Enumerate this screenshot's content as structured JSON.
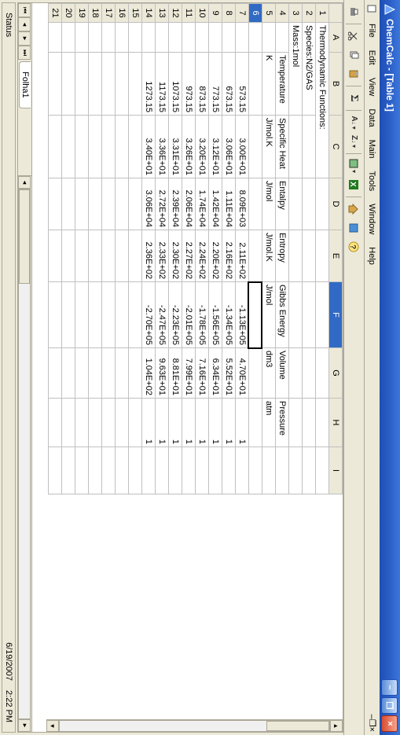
{
  "window": {
    "title": "ChemCalc - [Table 1]"
  },
  "menu": {
    "file": "File",
    "edit": "Edit",
    "view": "View",
    "data": "Data",
    "main": "Main",
    "tools": "Tools",
    "window": "Window",
    "help": "Help"
  },
  "columns": [
    "A",
    "B",
    "C",
    "D",
    "E",
    "F",
    "G",
    "H",
    "I"
  ],
  "rows": {
    "r1": {
      "A": "Thermodynamic Functions:"
    },
    "r2": {
      "A": "Species:N2/GAS"
    },
    "r3": {
      "A": "Mass:1mol"
    },
    "r4": {
      "B": "Temperature",
      "C": "Specific Heat",
      "D": "Entalpy",
      "E": "Entropy",
      "F": "Gibbs Energy",
      "G": "Volume",
      "H": "Pressure"
    },
    "r5": {
      "B": "K",
      "C": "J/mol.K",
      "D": "J/mol",
      "E": "J/mol.K",
      "F": "J/mol",
      "G": "dm3",
      "H": "atm"
    },
    "r7": {
      "B": "573.15",
      "C": "3.00E+01",
      "D": "8.09E+03",
      "E": "2.11E+02",
      "F": "-1.13E+05",
      "G": "4.70E+01",
      "H": "1"
    },
    "r8": {
      "B": "673.15",
      "C": "3.06E+01",
      "D": "1.11E+04",
      "E": "2.16E+02",
      "F": "-1.34E+05",
      "G": "5.52E+01",
      "H": "1"
    },
    "r9": {
      "B": "773.15",
      "C": "3.12E+01",
      "D": "1.42E+04",
      "E": "2.20E+02",
      "F": "-1.56E+05",
      "G": "6.34E+01",
      "H": "1"
    },
    "r10": {
      "B": "873.15",
      "C": "3.20E+01",
      "D": "1.74E+04",
      "E": "2.24E+02",
      "F": "-1.78E+05",
      "G": "7.16E+01",
      "H": "1"
    },
    "r11": {
      "B": "973.15",
      "C": "3.26E+01",
      "D": "2.06E+04",
      "E": "2.27E+02",
      "F": "-2.01E+05",
      "G": "7.99E+01",
      "H": "1"
    },
    "r12": {
      "B": "1073.15",
      "C": "3.31E+01",
      "D": "2.39E+04",
      "E": "2.30E+02",
      "F": "-2.23E+05",
      "G": "8.81E+01",
      "H": "1"
    },
    "r13": {
      "B": "1173.15",
      "C": "3.36E+01",
      "D": "2.72E+04",
      "E": "2.33E+02",
      "F": "-2.47E+05",
      "G": "9.63E+01",
      "H": "1"
    },
    "r14": {
      "B": "1273.15",
      "C": "3.40E+01",
      "D": "3.06E+04",
      "E": "2.36E+02",
      "F": "-2.70E+05",
      "G": "1.04E+02",
      "H": "1"
    }
  },
  "selected": {
    "col": "F",
    "row": 6
  },
  "sheet_tab": "Folha1",
  "status": {
    "label": "Status",
    "date": "6/19/2007",
    "time": "2:22 PM"
  }
}
